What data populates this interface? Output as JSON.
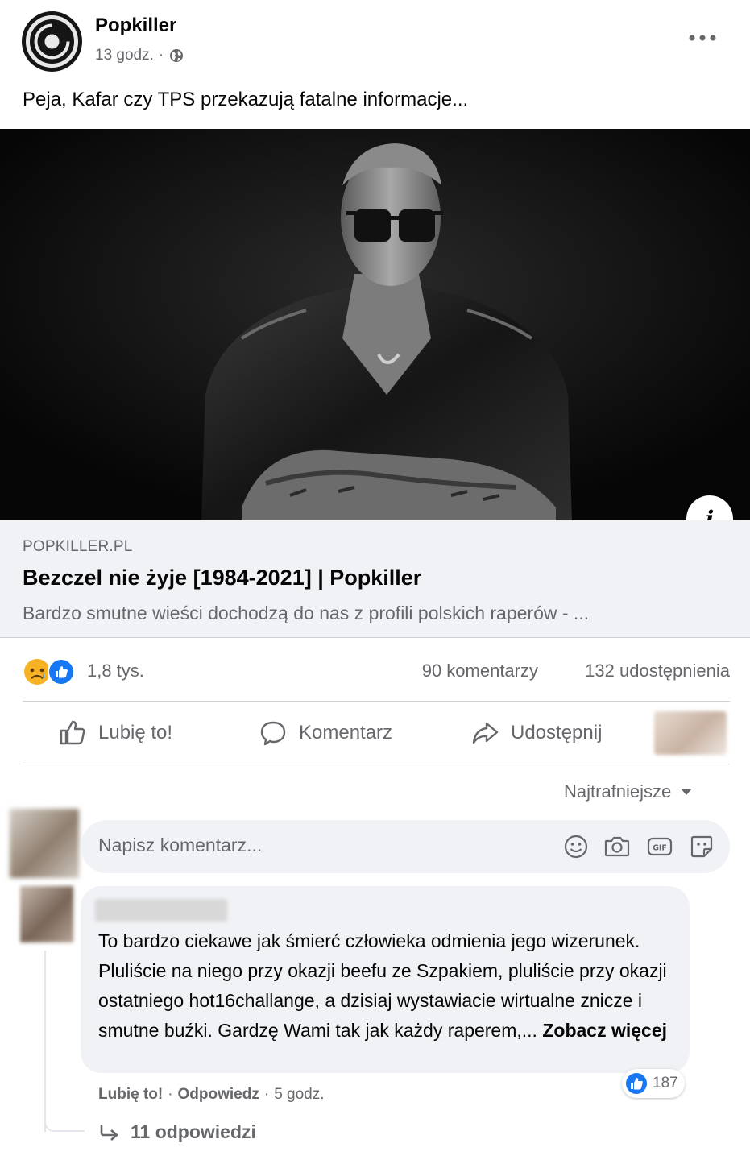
{
  "post": {
    "page_name": "Popkiller",
    "time": "13 godz.",
    "separator": "·",
    "text": "Peja, Kafar czy TPS przekazują fatalne informacje..."
  },
  "link_preview": {
    "domain": "POPKILLER.PL",
    "title": "Bezczel nie żyje [1984-2021] | Popkiller",
    "description": "Bardzo smutne wieści dochodzą do nas z profili polskich raperów - ..."
  },
  "stats": {
    "reactions": "1,8 tys.",
    "comments": "90 komentarzy",
    "shares": "132 udostępnienia",
    "reaction_types": [
      "sad-icon",
      "like-icon"
    ]
  },
  "actions": {
    "like": "Lubię to!",
    "comment": "Komentarz",
    "share": "Udostępnij"
  },
  "sort": {
    "label": "Najtrafniejsze"
  },
  "composer": {
    "placeholder": "Napisz komentarz..."
  },
  "comment": {
    "text": "To bardzo ciekawe jak śmierć człowieka odmienia jego wizerunek. Pluliście na niego przy okazji beefu ze Szpakiem, pluliście przy okazji ostatniego hot16challange, a dzisiaj wystawiacie wirtualne znicze i smutne buźki. Gardzę Wami tak jak każdy raperem,...",
    "see_more": "Zobacz więcej",
    "like_label": "Lubię to!",
    "reply_label": "Odpowiedz",
    "time": "5 godz.",
    "separator": "·",
    "reaction_count": "187",
    "replies": "11 odpowiedzi"
  },
  "colors": {
    "facebook_blue": "#1877f2",
    "secondary_text": "#65676b",
    "bubble_bg": "#f0f2f5"
  }
}
